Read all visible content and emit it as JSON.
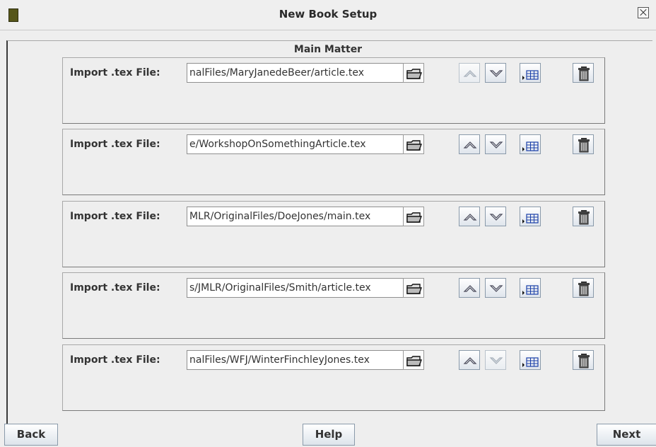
{
  "window": {
    "title": "New Book Setup"
  },
  "section": {
    "title": "Main Matter"
  },
  "entries": [
    {
      "label": "Import .tex File:",
      "path": "nalFiles/MaryJanedeBeer/article.tex",
      "up_enabled": false,
      "down_enabled": true
    },
    {
      "label": "Import .tex File:",
      "path": "e/WorkshopOnSomethingArticle.tex",
      "up_enabled": true,
      "down_enabled": true
    },
    {
      "label": "Import .tex File:",
      "path": "MLR/OriginalFiles/DoeJones/main.tex",
      "up_enabled": true,
      "down_enabled": true
    },
    {
      "label": "Import .tex File:",
      "path": "s/JMLR/OriginalFiles/Smith/article.tex",
      "up_enabled": true,
      "down_enabled": true
    },
    {
      "label": "Import .tex File:",
      "path": "nalFiles/WFJ/WinterFinchleyJones.tex",
      "up_enabled": true,
      "down_enabled": false
    }
  ],
  "buttons": {
    "back": "Back",
    "help": "Help",
    "next": "Next"
  },
  "icons": {
    "browse": "folder-icon",
    "up": "chevron-up-icon",
    "down": "chevron-down-icon",
    "table": "table-icon",
    "delete": "trash-icon"
  },
  "colors": {
    "button_border": "#8a9aaa",
    "window_bg": "#eeeeee",
    "app_icon": "#56561a"
  }
}
